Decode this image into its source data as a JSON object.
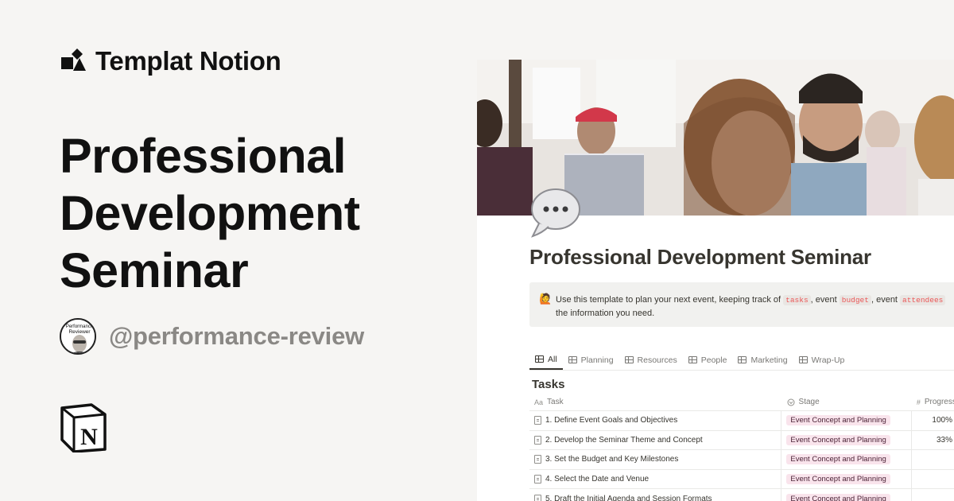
{
  "brand": {
    "name": "Templat Notion"
  },
  "hero": {
    "title": "Professional Development Seminar"
  },
  "author": {
    "handle": "@performance-review",
    "avatar_text_top": "Performance",
    "avatar_text_bottom": "Reviewer"
  },
  "preview": {
    "page_title": "Professional Development Seminar",
    "callout": {
      "icon": "🙋",
      "text_before": "Use this template to plan your next event, keeping track of ",
      "code1": "tasks",
      "mid1": ", event ",
      "code2": "budget",
      "mid2": ", event ",
      "code3": "attendees",
      "line2": "the information you need."
    },
    "tabs": [
      "All",
      "Planning",
      "Resources",
      "People",
      "Marketing",
      "Wrap-Up"
    ],
    "db_title": "Tasks",
    "columns": {
      "task": "Task",
      "task_prefix": "Aa",
      "stage": "Stage",
      "progress": "Progress",
      "progress_prefix": "#"
    },
    "rows": [
      {
        "task": "1. Define Event Goals and Objectives",
        "stage": "Event Concept and Planning",
        "progress": "100%"
      },
      {
        "task": "2. Develop the Seminar Theme and Concept",
        "stage": "Event Concept and Planning",
        "progress": "33%"
      },
      {
        "task": "3. Set the Budget and Key Milestones",
        "stage": "Event Concept and Planning",
        "progress": ""
      },
      {
        "task": "4. Select the Date and Venue",
        "stage": "Event Concept and Planning",
        "progress": ""
      },
      {
        "task": "5. Draft the Initial Agenda and Session Formats",
        "stage": "Event Concept and Planning",
        "progress": ""
      }
    ]
  },
  "colors": {
    "background": "#f6f5f3",
    "tag_bg": "#f9e4ec",
    "code_red": "#eb5757",
    "handle_gray": "#8a8885"
  },
  "icons": {
    "brand": "shapes-icon",
    "notion": "notion-logo-icon",
    "page": "speech-bubble-icon"
  }
}
